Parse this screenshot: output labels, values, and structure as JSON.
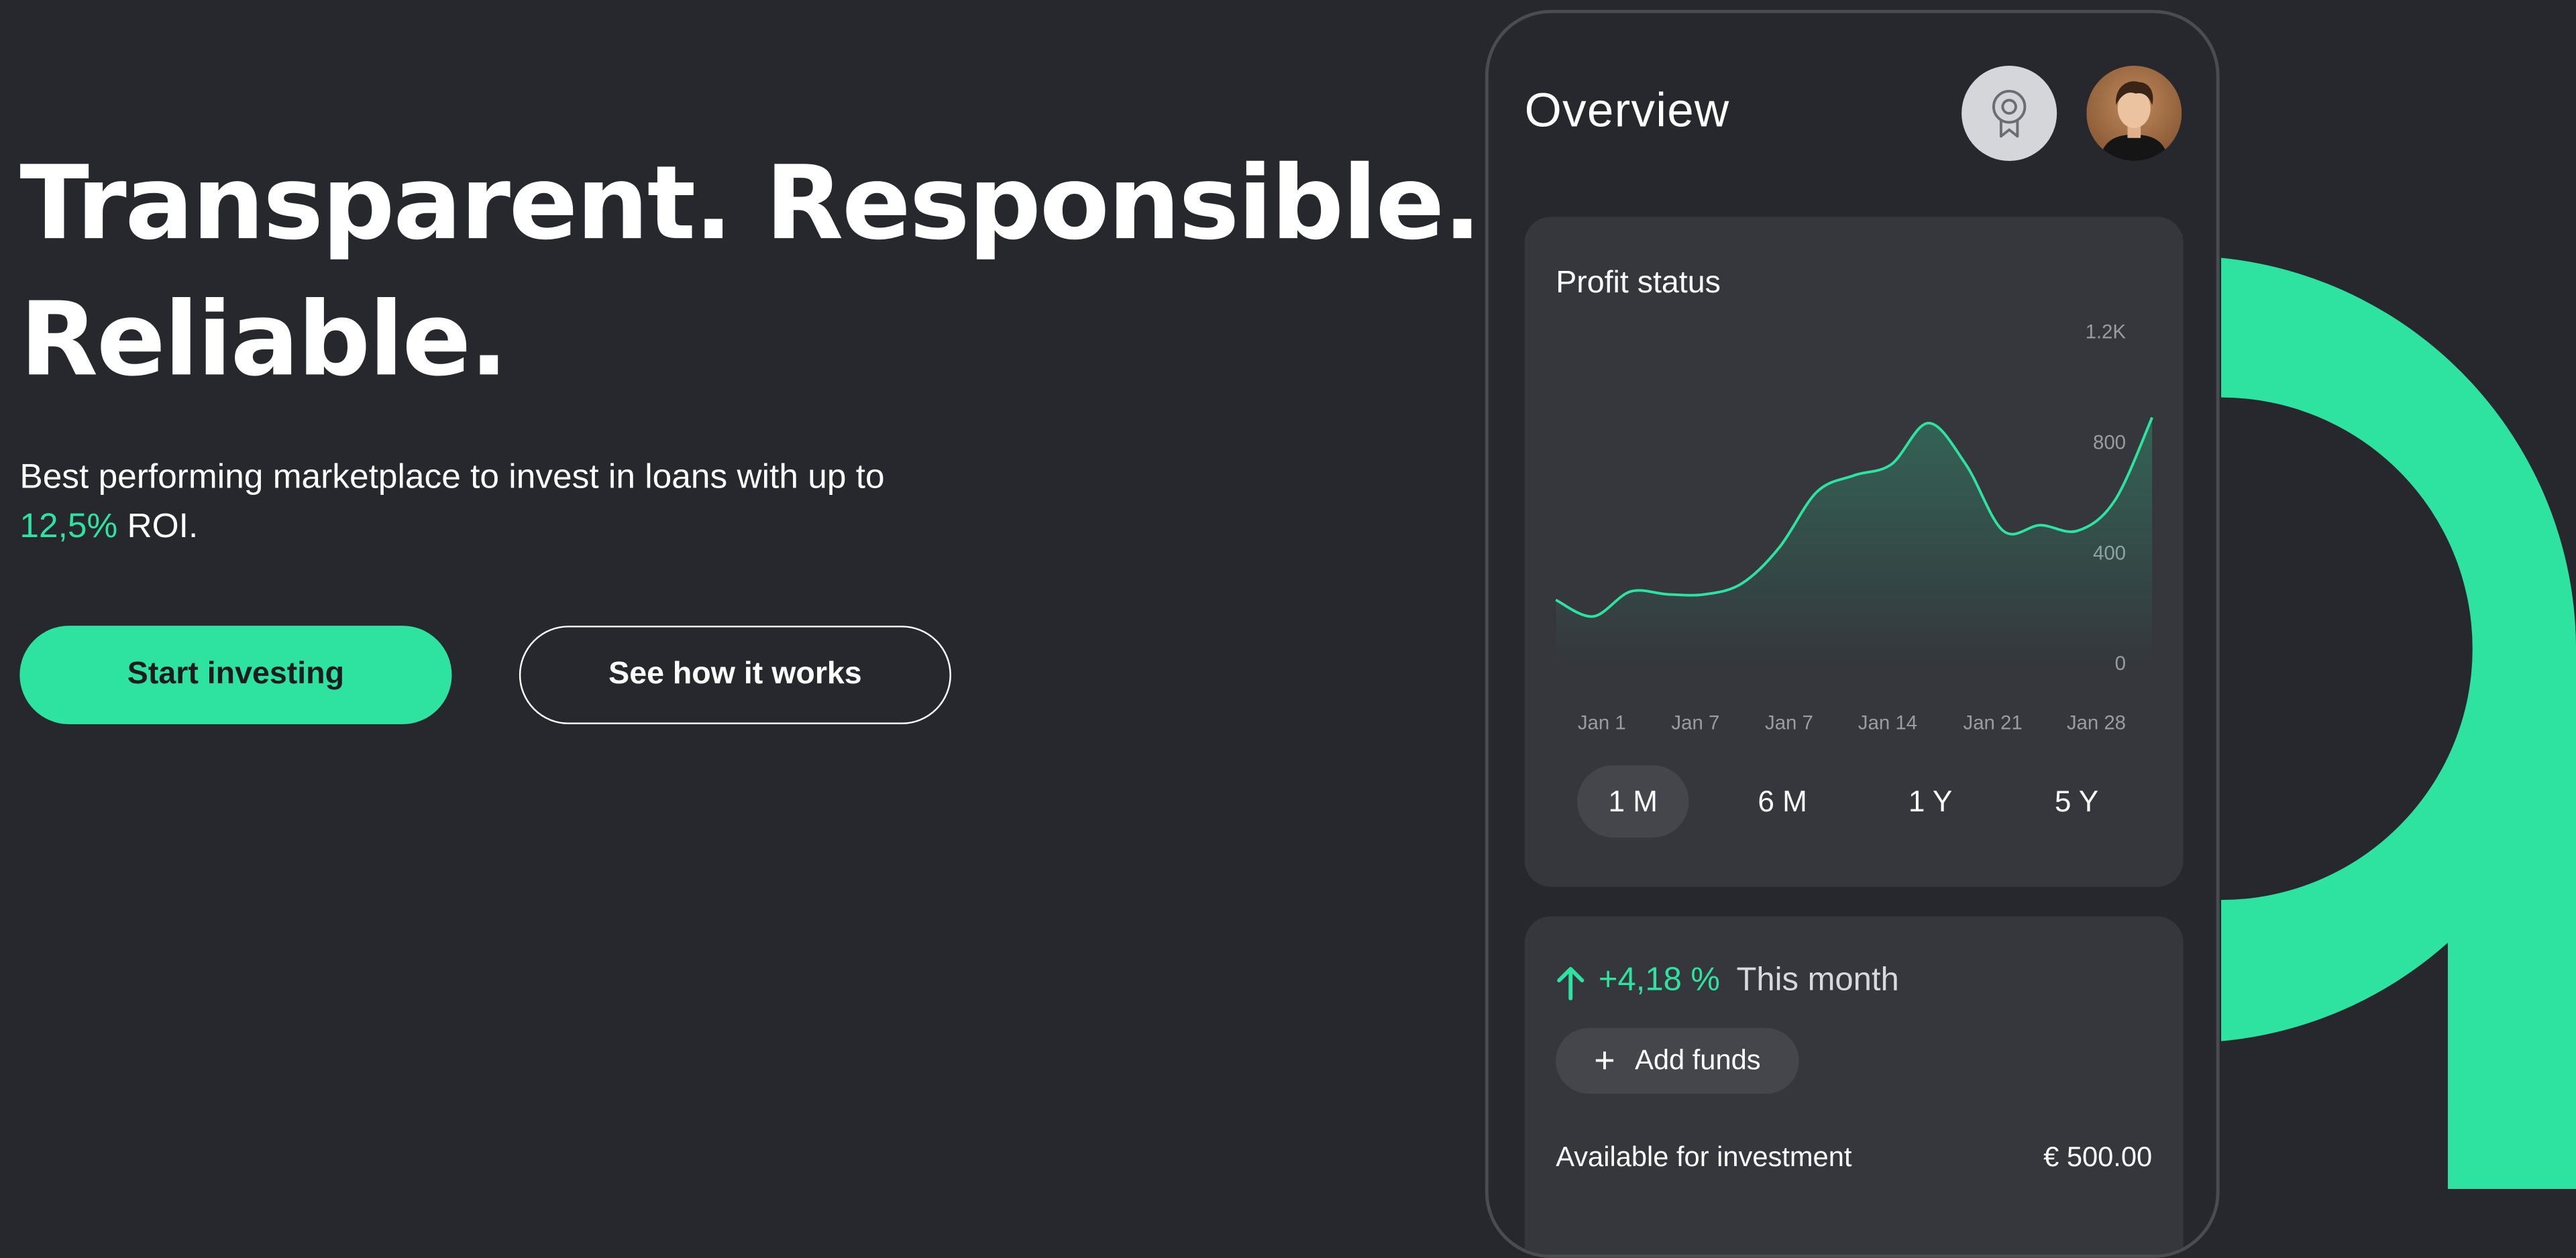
{
  "hero": {
    "headline_line1": "Transparent. Responsible.",
    "headline_line2": "Reliable.",
    "subtext_prefix": "Best performing marketplace to invest in loans with up to ",
    "subtext_highlight": "12,5%",
    "subtext_suffix": " ROI.",
    "primary_button": "Start investing",
    "secondary_button": "See how it works"
  },
  "app": {
    "title": "Overview",
    "badge_icon": "award-icon",
    "profit_card": {
      "title": "Profit status",
      "ranges": [
        "1 M",
        "6 M",
        "1 Y",
        "5 Y"
      ],
      "active_range": "1 M"
    },
    "month_card": {
      "trend_icon": "arrow-up-icon",
      "change": "+4,18 %",
      "period": "This month",
      "add_funds_label": "Add funds",
      "available_label": "Available for investment",
      "available_value": "€ 500.00"
    }
  },
  "colors": {
    "accent": "#2ee29f",
    "background": "#27282d",
    "card": "#35373c"
  },
  "chart_data": {
    "type": "area",
    "title": "",
    "xlabel": "",
    "ylabel": "",
    "x_tick_labels": [
      "Jan 1",
      "Jan 7",
      "Jan 7",
      "Jan 14",
      "Jan 21",
      "Jan 28"
    ],
    "y_tick_labels": [
      "0",
      "400",
      "800",
      "1.2K"
    ],
    "ylim": [
      0,
      1200
    ],
    "grid": false,
    "series": [
      {
        "values": [
          230,
          170,
          260,
          250,
          250,
          290,
          420,
          620,
          680,
          720,
          870,
          720,
          480,
          500,
          480,
          590,
          890
        ]
      }
    ]
  }
}
